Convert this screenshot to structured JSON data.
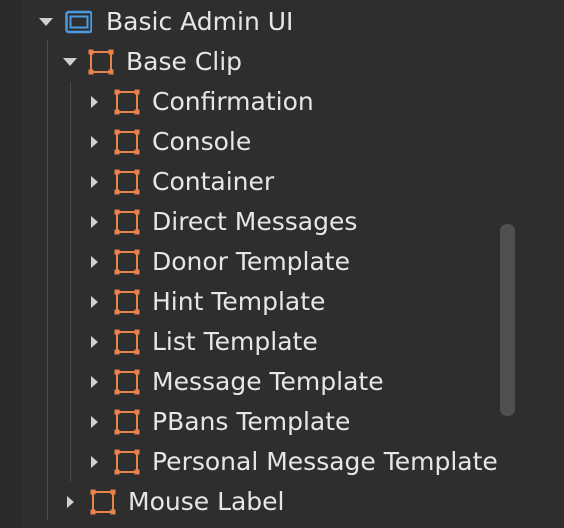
{
  "tree": {
    "root": {
      "label": "Basic Admin UI",
      "icon": "window-icon",
      "expanded": true
    },
    "base_clip": {
      "label": "Base Clip",
      "icon": "frame-icon",
      "expanded": true
    },
    "children": [
      {
        "label": "Confirmation",
        "icon": "frame-icon"
      },
      {
        "label": "Console",
        "icon": "frame-icon"
      },
      {
        "label": "Container",
        "icon": "frame-icon"
      },
      {
        "label": "Direct Messages",
        "icon": "frame-icon"
      },
      {
        "label": "Donor Template",
        "icon": "frame-icon"
      },
      {
        "label": "Hint Template",
        "icon": "frame-icon"
      },
      {
        "label": "List Template",
        "icon": "frame-icon"
      },
      {
        "label": "Message Template",
        "icon": "frame-icon"
      },
      {
        "label": "PBans Template",
        "icon": "frame-icon"
      },
      {
        "label": "Personal Message Template",
        "icon": "frame-icon"
      }
    ],
    "mouse_label": {
      "label": "Mouse Label",
      "icon": "frame-icon",
      "expanded": false
    }
  },
  "colors": {
    "background": "#2e2e2e",
    "text": "#e6e6e6",
    "frame_icon": "#e8834a",
    "window_icon": "#4a9be0",
    "scrollbar": "#505050"
  }
}
